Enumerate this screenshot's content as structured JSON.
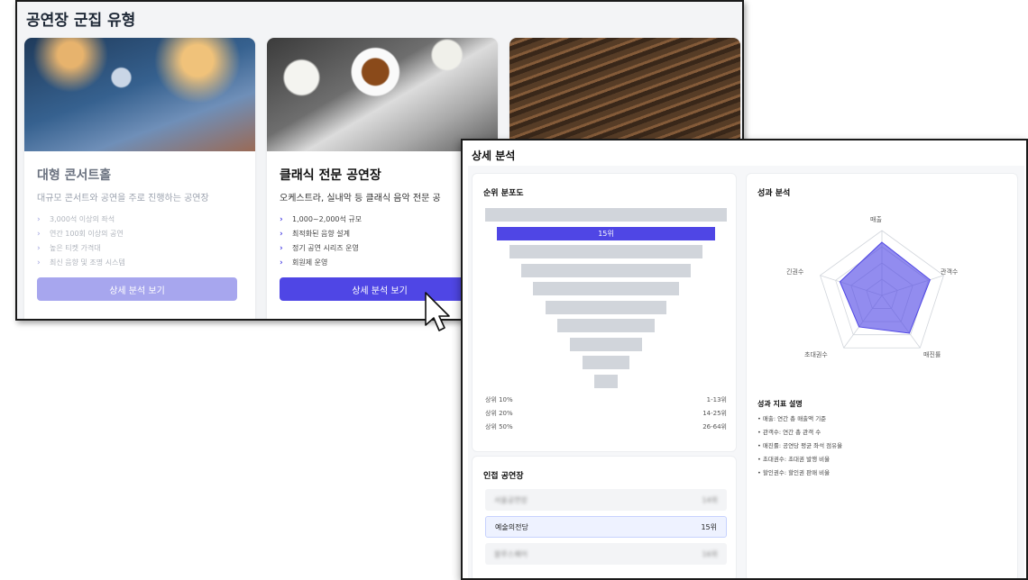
{
  "back": {
    "title": "공연장 군집 유형",
    "cards": [
      {
        "title": "대형 콘서트홀",
        "desc": "대규모 콘서트와 공연을 주로 진행하는 공연장",
        "features": [
          "3,000석 이상의 좌석",
          "연간 100회 이상의 공연",
          "높은 티켓 가격대",
          "최신 음향 및 조명 시스템"
        ],
        "button": "상세 분석 보기"
      },
      {
        "title": "클래식 전문 공연장",
        "desc": "오케스트라, 실내악 등 클래식 음악 전문 공",
        "features": [
          "1,000~2,000석 규모",
          "최적화된 음향 설계",
          "정기 공연 시리즈 운영",
          "회원제 운영"
        ],
        "button": "상세 분석 보기"
      }
    ]
  },
  "detail": {
    "title": "상세 분석",
    "funnel": {
      "title": "순위 분포도",
      "highlight_label": "15위",
      "legend": [
        {
          "label": "상위 10%",
          "range": "1-13위"
        },
        {
          "label": "상위 20%",
          "range": "14-25위"
        },
        {
          "label": "상위 50%",
          "range": "26-64위"
        }
      ]
    },
    "neighbors": {
      "title": "인접 공연장",
      "rows": [
        {
          "name": "서울공연장",
          "rank": "14위"
        },
        {
          "name": "예술의전당",
          "rank": "15위"
        },
        {
          "name": "블루스퀘어",
          "rank": "16위"
        }
      ]
    },
    "radar": {
      "title": "성과 분석",
      "axes": [
        "매출",
        "관객수",
        "매진률",
        "초대권수",
        "긴권수"
      ],
      "values": [
        0.82,
        0.78,
        0.72,
        0.6,
        0.68
      ]
    },
    "metrics": {
      "title": "성과 지표 설명",
      "items": [
        "• 매출: 연간 총 매출액 기준",
        "• 관객수: 연간 총 관객 수",
        "• 매진률: 공연당 평균 좌석 점유율",
        "• 초대권수: 초대권 발행 비율",
        "• 할인권수: 할인권 판매 비율"
      ]
    }
  },
  "colors": {
    "accent": "#4f46e5",
    "accent_light": "#a7a6ee",
    "bar_gray": "#d1d5db"
  }
}
